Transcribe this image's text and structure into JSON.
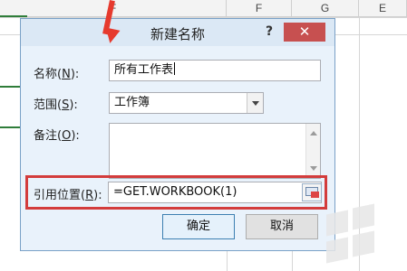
{
  "spreadsheet": {
    "columns": [
      "F",
      "F",
      "G",
      "E"
    ]
  },
  "dialog": {
    "title": "新建名称",
    "help_label": "?",
    "close_label": "✕",
    "name_label_prefix": "名称(",
    "name_label_key": "N",
    "name_label_suffix": "):",
    "name_value": "所有工作表",
    "scope_label_prefix": "范围(",
    "scope_label_key": "S",
    "scope_label_suffix": "):",
    "scope_value": "工作簿",
    "comment_label_prefix": "备注(",
    "comment_label_key": "O",
    "comment_label_suffix": "):",
    "ref_label_prefix": "引用位置(",
    "ref_label_key": "R",
    "ref_label_suffix": "):",
    "ref_value": "=GET.WORKBOOK(1)",
    "ok_label": "确定",
    "cancel_label": "取消",
    "highlight_color": "#d33c3c"
  },
  "icons": {
    "arrow": "red-down-arrow",
    "ref": "range-select-icon"
  }
}
